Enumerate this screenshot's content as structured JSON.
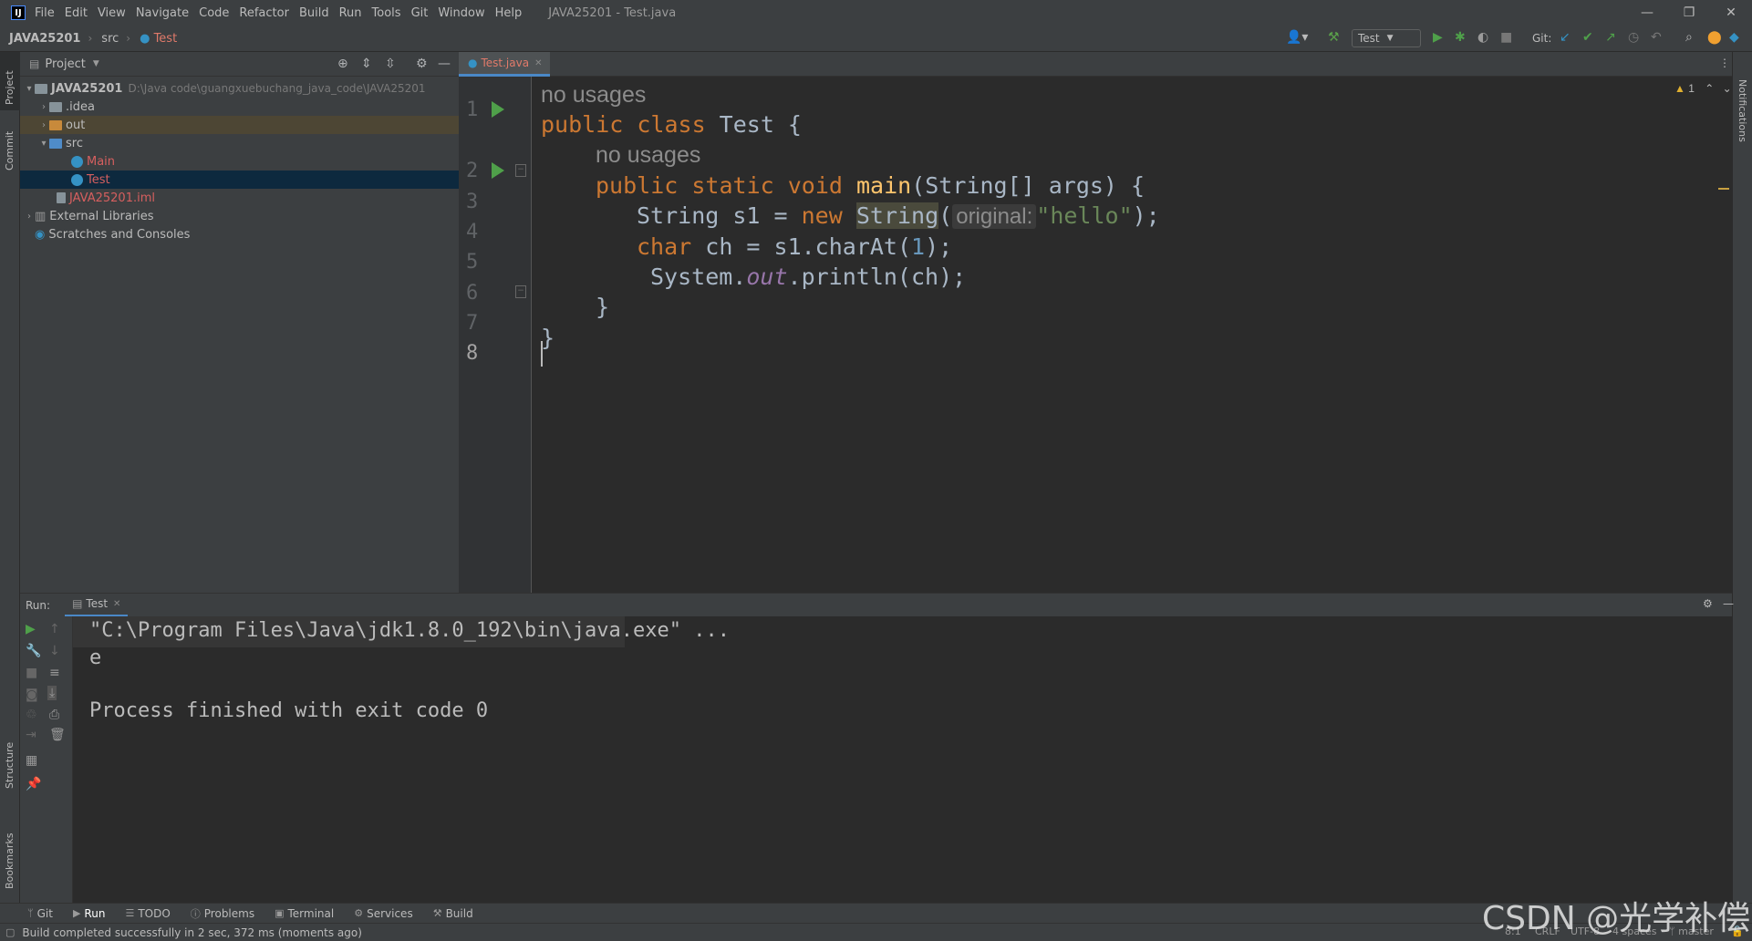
{
  "menubar": {
    "items": [
      "File",
      "Edit",
      "View",
      "Navigate",
      "Code",
      "Refactor",
      "Build",
      "Run",
      "Tools",
      "Git",
      "Window",
      "Help"
    ],
    "window_title": "JAVA25201 - Test.java"
  },
  "navbar": {
    "project": "JAVA25201",
    "folder": "src",
    "file": "Test",
    "run_config": "Test",
    "git_label": "Git:"
  },
  "project_panel": {
    "title": "Project",
    "tree": [
      {
        "label": "JAVA25201",
        "path": "D:\\Java code\\guangxuebuchang_java_code\\JAVA25201"
      },
      {
        "label": ".idea"
      },
      {
        "label": "out"
      },
      {
        "label": "src"
      },
      {
        "label": "Main"
      },
      {
        "label": "Test"
      },
      {
        "label": "JAVA25201.iml"
      },
      {
        "label": "External Libraries"
      },
      {
        "label": "Scratches and Consoles"
      }
    ]
  },
  "editor": {
    "tab": "Test.java",
    "warning_count": "1",
    "usages_hint": "no usages",
    "param_hint": "original:",
    "line_numbers": [
      "1",
      "2",
      "3",
      "4",
      "5",
      "6",
      "7",
      "8"
    ],
    "code": {
      "l1_kw": "public class ",
      "l1_rest": "Test {",
      "l2_kw": "public static void ",
      "l2_fn": "main",
      "l2_rest": "(String[] args) {",
      "l3_a": "String s1 = ",
      "l3_kw": "new ",
      "l3_cls": "String",
      "l3_paren": "(",
      "l3_str": "\"hello\"",
      "l3_end": ");",
      "l4_kw": "char ",
      "l4_a": "ch = s1.charAt(",
      "l4_num": "1",
      "l4_end": ");",
      "l5_a": "System.",
      "l5_out": "out",
      "l5_b": ".println(ch);",
      "l6": "}",
      "l7": "}"
    }
  },
  "run_panel": {
    "label": "Run:",
    "tab": "Test",
    "console": [
      "\"C:\\Program Files\\Java\\jdk1.8.0_192\\bin\\java.exe\" ...",
      "e",
      "",
      "Process finished with exit code 0"
    ]
  },
  "sidebar": {
    "left": [
      "Project",
      "Commit",
      "Structure",
      "Bookmarks"
    ],
    "right": [
      "Notifications"
    ]
  },
  "bottom_tabs": [
    "Git",
    "Run",
    "TODO",
    "Problems",
    "Terminal",
    "Services",
    "Build"
  ],
  "status": {
    "message": "Build completed successfully in 2 sec, 372 ms (moments ago)",
    "position": "8:1",
    "line_sep": "CRLF",
    "encoding": "UTF-8",
    "indent": "4 spaces",
    "branch": "master"
  },
  "watermark": "CSDN @光学补偿"
}
